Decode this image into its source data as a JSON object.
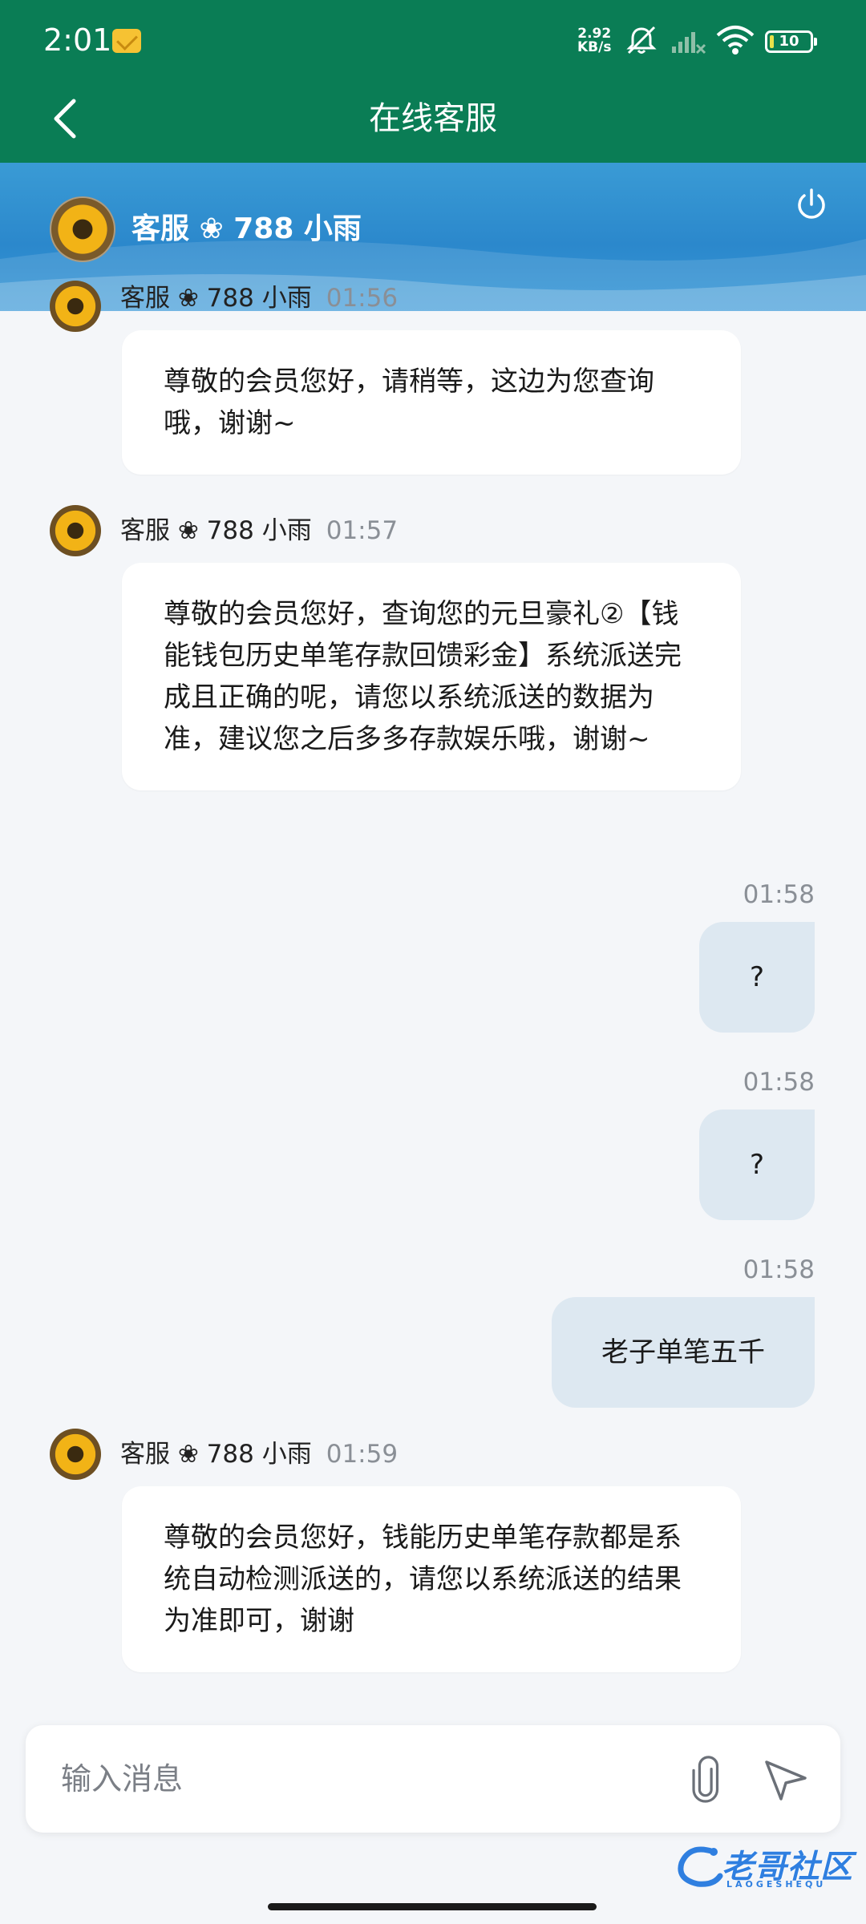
{
  "status_bar": {
    "time": "2:01",
    "net_speed_value": "2.92",
    "net_speed_unit": "KB/s",
    "battery": "10"
  },
  "header": {
    "title": "在线客服"
  },
  "agent": {
    "name": "客服 ❀ 788 小雨"
  },
  "messages": [
    {
      "sender": "客服 ❀ 788 小雨",
      "time": "01:56",
      "text": "尊敬的会员您好，请稍等，这边为您查询哦，谢谢~"
    },
    {
      "sender": "客服 ❀ 788 小雨",
      "time": "01:57",
      "text": "尊敬的会员您好，查询您的元旦豪礼②【钱能钱包历史单笔存款回馈彩金】系统派送完成且正确的呢，请您以系统派送的数据为准，建议您之后多多存款娱乐哦，谢谢~"
    },
    {
      "sender": "me",
      "time": "01:58",
      "text": "?"
    },
    {
      "sender": "me",
      "time": "01:58",
      "text": "?"
    },
    {
      "sender": "me",
      "time": "01:58",
      "text": "老子单笔五千"
    },
    {
      "sender": "客服 ❀ 788 小雨",
      "time": "01:59",
      "text": "尊敬的会员您好，钱能历史单笔存款都是系统自动检测派送的，请您以系统派送的结果为准即可，谢谢"
    }
  ],
  "composer": {
    "placeholder": "输入消息"
  },
  "watermark": {
    "text": "老哥社区",
    "sub": "LAOGESHEQU"
  },
  "colors": {
    "app_bar": "#0a7d55",
    "banner": "#2b88cc",
    "outgoing_bubble": "#dde8f1",
    "incoming_bubble": "#ffffff"
  }
}
